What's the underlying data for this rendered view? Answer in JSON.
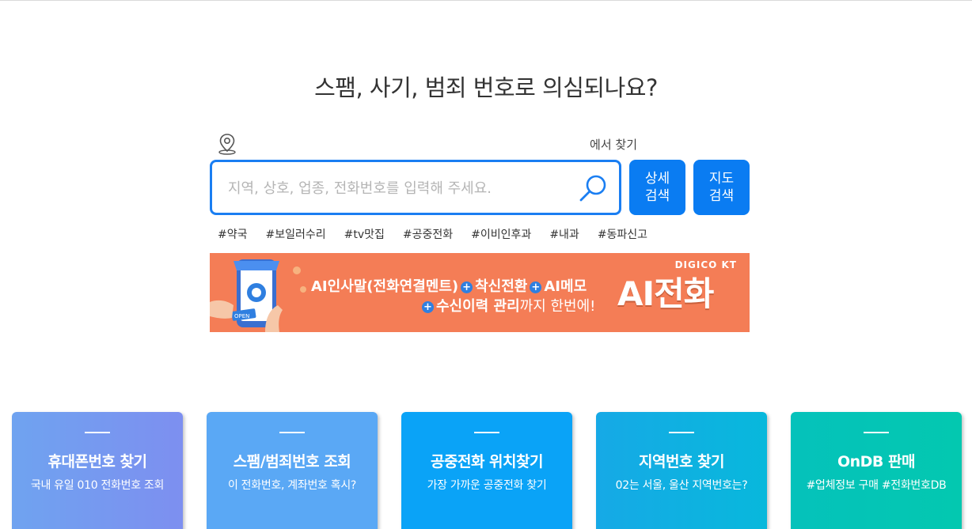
{
  "headline": "스팸, 사기, 범죄 번호로 의심되나요?",
  "location": {
    "label": "에서 찾기",
    "icon": "map-pin-icon"
  },
  "search": {
    "placeholder": "지역, 상호, 업종, 전화번호를 입력해 주세요.",
    "value": "",
    "icon": "search-icon",
    "accent_color": "#1a7ef2"
  },
  "buttons": {
    "detail_line1": "상세",
    "detail_line2": "검색",
    "map_line1": "지도",
    "map_line2": "검색"
  },
  "tags": [
    "#약국",
    "#보일러수리",
    "#tv맛집",
    "#공중전화",
    "#이비인후과",
    "#내과",
    "#동파신고"
  ],
  "banner": {
    "brand": "DIGICO KT",
    "line1_a": "AI인사말(전화연결멘트)",
    "line1_b": "착신전환",
    "line1_c": "AI메모",
    "line2_a": "수신이력 관리",
    "line2_b": "까지 한번에!",
    "big_text": "AI전화",
    "bg_color": "#f47d56",
    "phone_label": "OPEN"
  },
  "cards": [
    {
      "title": "휴대폰번호 찾기",
      "subtitle": "국내 유일 010 전화번호 조회"
    },
    {
      "title": "스팸/범죄번호 조회",
      "subtitle": "이 전화번호, 계좌번호 혹시?"
    },
    {
      "title": "공중전화 위치찾기",
      "subtitle": "가장 가까운 공중전화 찾기"
    },
    {
      "title": "지역번호 찾기",
      "subtitle": "02는 서울, 울산 지역번호는?"
    },
    {
      "title": "OnDB 판매",
      "subtitle": "#업체정보 구매 #전화번호DB"
    }
  ]
}
